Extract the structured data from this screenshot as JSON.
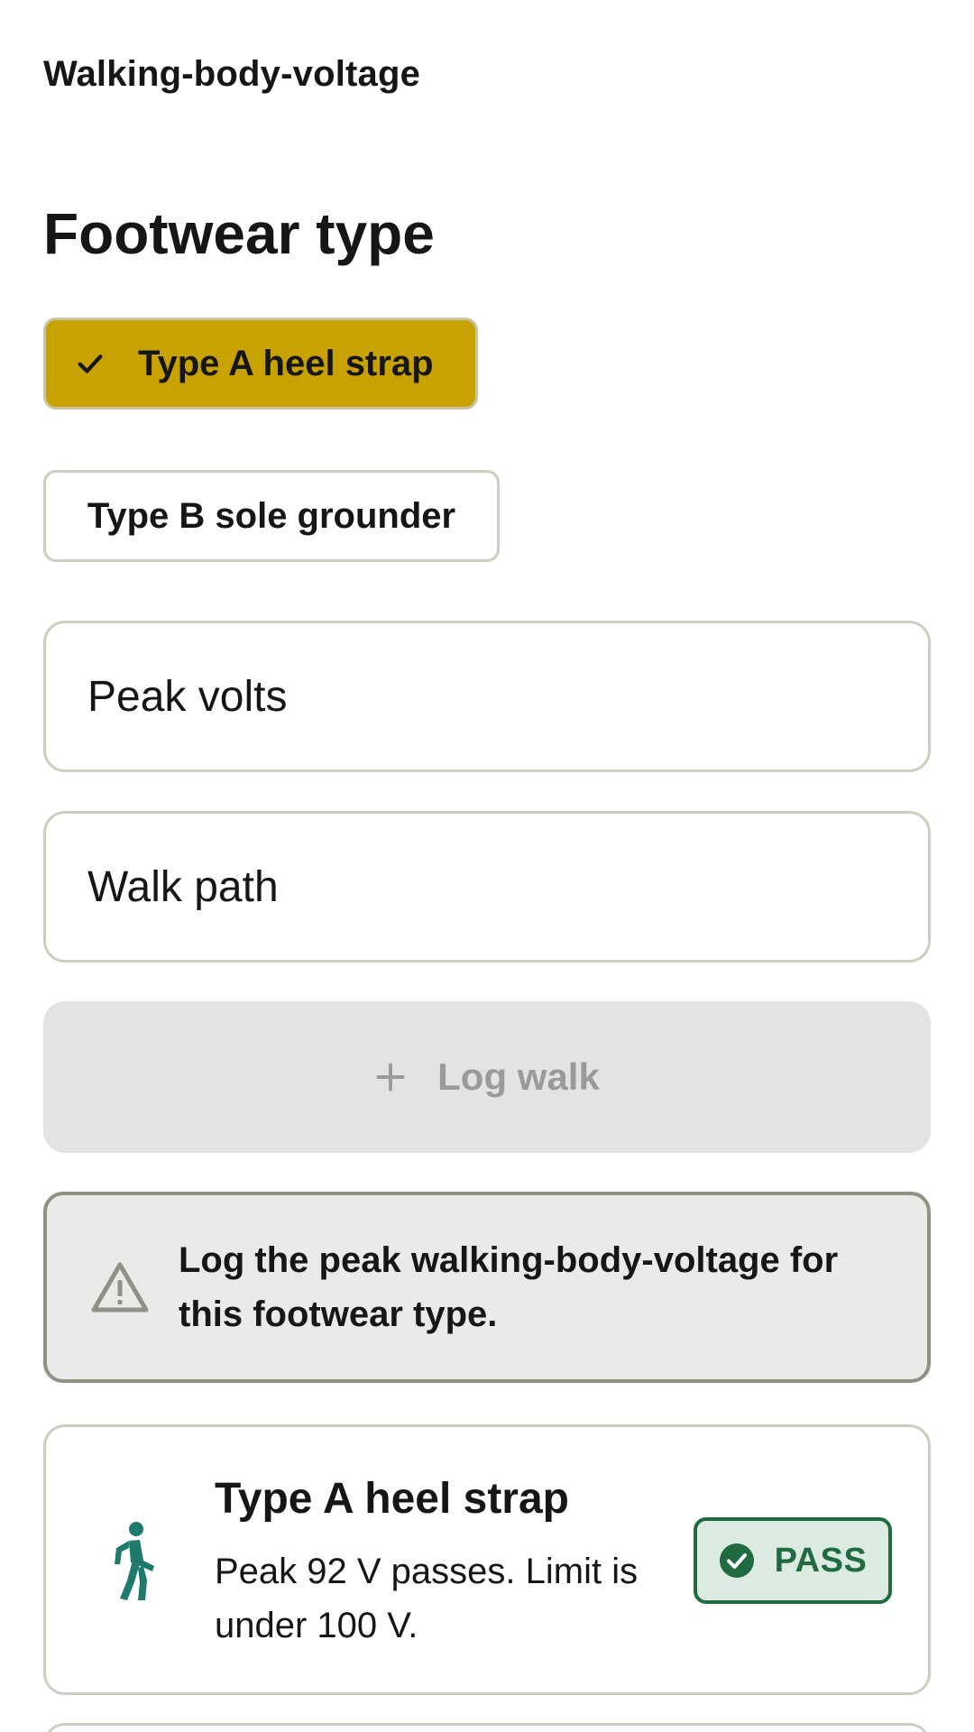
{
  "app": {
    "title": "Walking-body-voltage"
  },
  "footwear": {
    "heading": "Footwear type",
    "options": [
      {
        "label": "Type A heel strap",
        "selected": true
      },
      {
        "label": "Type B sole grounder",
        "selected": false
      }
    ]
  },
  "form": {
    "peak_volts_placeholder": "Peak volts",
    "walk_path_placeholder": "Walk path",
    "log_label": "Log walk"
  },
  "alert": {
    "text": "Log the peak walking-body-voltage for this footwear type."
  },
  "results": [
    {
      "title": "Type A heel strap",
      "description": "Peak 92 V passes. Limit is under 100 V.",
      "status": "PASS",
      "icon": "walking-person-icon"
    }
  ],
  "colors": {
    "selected_chip": "#c8a200",
    "pass_green": "#1f6b3f",
    "walker_teal": "#1f7a6e",
    "alert_bg": "#e9ebe8",
    "disabled_bg": "#e3e3e3"
  }
}
